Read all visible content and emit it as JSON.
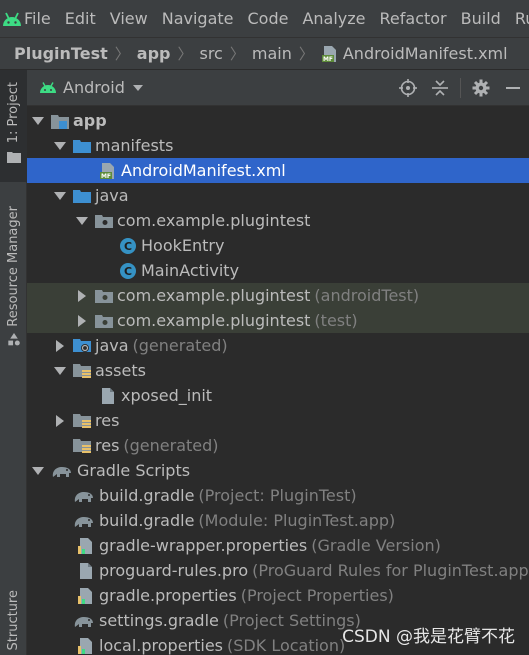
{
  "menubar": {
    "items": [
      {
        "label": "File"
      },
      {
        "label": "Edit"
      },
      {
        "label": "View"
      },
      {
        "label": "Navigate"
      },
      {
        "label": "Code"
      },
      {
        "label": "Analyze"
      },
      {
        "label": "Refactor"
      },
      {
        "label": "Build"
      },
      {
        "label": "Ru"
      }
    ]
  },
  "breadcrumb": {
    "project": "PluginTest",
    "module": "app",
    "src": "src",
    "main": "main",
    "file": "AndroidManifest.xml",
    "file_icon_text": "MF"
  },
  "leftstrip": {
    "project_tab": "1: Project",
    "resource_tab": "Resource Manager",
    "structure_tab": "Structure"
  },
  "panel": {
    "view_mode": "Android"
  },
  "tree": {
    "app": "app",
    "manifests": "manifests",
    "manifest_file": "AndroidManifest.xml",
    "manifest_icon_text": "MF",
    "java": "java",
    "pkg_main": "com.example.plugintest",
    "class_icon_text": "C",
    "class1": "HookEntry",
    "class2": "MainActivity",
    "pkg_android_test": "com.example.plugintest",
    "pkg_android_test_hint": "(androidTest)",
    "pkg_test": "com.example.plugintest",
    "pkg_test_hint": "(test)",
    "java_generated": "java",
    "java_generated_hint": "(generated)",
    "assets": "assets",
    "xposed_init": "xposed_init",
    "res": "res",
    "res_generated": "res",
    "res_generated_hint": "(generated)",
    "gradle_scripts": "Gradle Scripts",
    "build_gradle_project": "build.gradle",
    "build_gradle_project_hint": "(Project: PluginTest)",
    "build_gradle_module": "build.gradle",
    "build_gradle_module_hint": "(Module: PluginTest.app)",
    "gradle_wrapper": "gradle-wrapper.properties",
    "gradle_wrapper_hint": "(Gradle Version)",
    "proguard": "proguard-rules.pro",
    "proguard_hint": "(ProGuard Rules for PluginTest.app)",
    "gradle_properties": "gradle.properties",
    "gradle_properties_hint": "(Project Properties)",
    "settings_gradle": "settings.gradle",
    "settings_gradle_hint": "(Project Settings)",
    "local_properties": "local.properties",
    "local_properties_hint": "(SDK Location)"
  },
  "watermark": "CSDN @我是花臂不花",
  "colors": {
    "selection": "#2f65ca",
    "folder_blue": "#3d8fd1",
    "android_green": "#3ddc84",
    "class_icon": "#3592c4"
  }
}
